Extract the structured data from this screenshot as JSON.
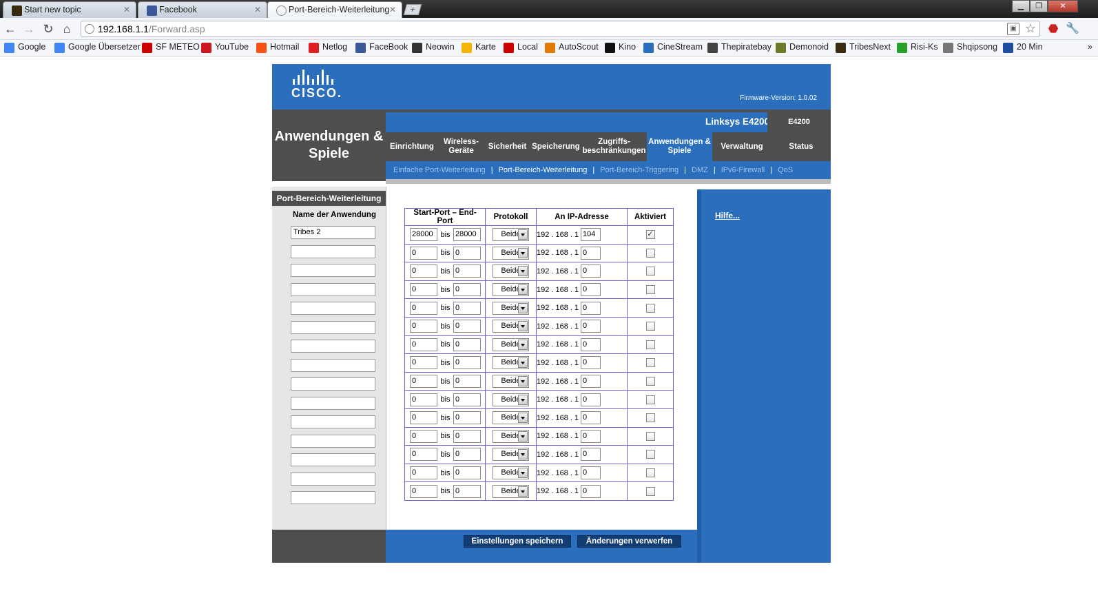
{
  "browser": {
    "tabs": [
      {
        "title": "Start new topic",
        "icon": "tribes-favicon",
        "color": "#3a2a10"
      },
      {
        "title": "Facebook",
        "icon": "facebook-favicon",
        "color": "#3b5998"
      },
      {
        "title": "Port-Bereich-Weiterleitung",
        "icon": "globe-favicon",
        "color": "#888888"
      }
    ],
    "new_tab_label": "+",
    "url_host": "192.168.1.1",
    "url_path": "/Forward.asp",
    "bookmarks": [
      {
        "label": "Google",
        "icon": "google-icon",
        "color": "#4285f4"
      },
      {
        "label": "Google Übersetzer",
        "icon": "translate-icon",
        "color": "#4285f4"
      },
      {
        "label": "SF METEO",
        "icon": "sf-icon",
        "color": "#cc0000"
      },
      {
        "label": "YouTube",
        "icon": "youtube-icon",
        "color": "#cc181e"
      },
      {
        "label": "Hotmail",
        "icon": "windows-icon",
        "color": "#f65314"
      },
      {
        "label": "Netlog",
        "icon": "netlog-icon",
        "color": "#e02020"
      },
      {
        "label": "FaceBook",
        "icon": "facebook-icon",
        "color": "#3b5998"
      },
      {
        "label": "Neowin",
        "icon": "neowin-icon",
        "color": "#333333"
      },
      {
        "label": "Karte",
        "icon": "map-icon",
        "color": "#f4b400"
      },
      {
        "label": "Local",
        "icon": "local-icon",
        "color": "#cc0000"
      },
      {
        "label": "AutoScout",
        "icon": "car-icon",
        "color": "#e07b00"
      },
      {
        "label": "Kino",
        "icon": "kino-icon",
        "color": "#111111"
      },
      {
        "label": "CineStream",
        "icon": "monitor-icon",
        "color": "#2a6ebc"
      },
      {
        "label": "Thepiratebay",
        "icon": "ship-icon",
        "color": "#444444"
      },
      {
        "label": "Demonoid",
        "icon": "demonoid-icon",
        "color": "#6b7a2a"
      },
      {
        "label": "TribesNext",
        "icon": "tribes-icon",
        "color": "#3a2a10"
      },
      {
        "label": "Risi-Ks",
        "icon": "r-icon",
        "color": "#2aa02a"
      },
      {
        "label": "Shqipsong",
        "icon": "globe-icon",
        "color": "#777777"
      },
      {
        "label": "20 Min",
        "icon": "20min-icon",
        "color": "#1f4ea0"
      }
    ]
  },
  "router": {
    "logo_text": "CISCO.",
    "firmware": "Firmware-Version: 1.0.02",
    "section_title_1": "Anwendungen &",
    "section_title_2": "Spiele",
    "model_name": "Linksys E4200",
    "model_badge": "E4200",
    "main_tabs": [
      {
        "l1": "Einrichtung",
        "l2": ""
      },
      {
        "l1": "Wireless-",
        "l2": "Geräte"
      },
      {
        "l1": "Sicherheit",
        "l2": ""
      },
      {
        "l1": "Speicherung",
        "l2": ""
      },
      {
        "l1": "Zugriffs-",
        "l2": "beschränkungen"
      },
      {
        "l1": "Anwendungen &",
        "l2": "Spiele"
      },
      {
        "l1": "Verwaltung",
        "l2": ""
      },
      {
        "l1": "Status",
        "l2": ""
      }
    ],
    "sub_tabs": [
      "Einfache Port-Weiterleitung",
      "Port-Bereich-Weiterleitung",
      "Port-Bereich-Triggering",
      "DMZ",
      "IPv6-Firewall",
      "QoS"
    ],
    "sub_active": 1,
    "left_section": "Port-Bereich-Weiterleitung",
    "name_header": "Name der Anwendung",
    "help_link": "Hilfe...",
    "table_headers": [
      "Start-Port – End-Port",
      "Protokoll",
      "An IP-Adresse",
      "Aktiviert"
    ],
    "bis_label": "bis",
    "ip_prefix": "192 . 168 . 1 .",
    "rows": [
      {
        "name": "Tribes 2",
        "start": "28000",
        "end": "28000",
        "protocol": "Beide",
        "ip": "104",
        "enabled": true
      },
      {
        "name": "",
        "start": "0",
        "end": "0",
        "protocol": "Beide",
        "ip": "0",
        "enabled": false
      },
      {
        "name": "",
        "start": "0",
        "end": "0",
        "protocol": "Beide",
        "ip": "0",
        "enabled": false
      },
      {
        "name": "",
        "start": "0",
        "end": "0",
        "protocol": "Beide",
        "ip": "0",
        "enabled": false
      },
      {
        "name": "",
        "start": "0",
        "end": "0",
        "protocol": "Beide",
        "ip": "0",
        "enabled": false
      },
      {
        "name": "",
        "start": "0",
        "end": "0",
        "protocol": "Beide",
        "ip": "0",
        "enabled": false
      },
      {
        "name": "",
        "start": "0",
        "end": "0",
        "protocol": "Beide",
        "ip": "0",
        "enabled": false
      },
      {
        "name": "",
        "start": "0",
        "end": "0",
        "protocol": "Beide",
        "ip": "0",
        "enabled": false
      },
      {
        "name": "",
        "start": "0",
        "end": "0",
        "protocol": "Beide",
        "ip": "0",
        "enabled": false
      },
      {
        "name": "",
        "start": "0",
        "end": "0",
        "protocol": "Beide",
        "ip": "0",
        "enabled": false
      },
      {
        "name": "",
        "start": "0",
        "end": "0",
        "protocol": "Beide",
        "ip": "0",
        "enabled": false
      },
      {
        "name": "",
        "start": "0",
        "end": "0",
        "protocol": "Beide",
        "ip": "0",
        "enabled": false
      },
      {
        "name": "",
        "start": "0",
        "end": "0",
        "protocol": "Beide",
        "ip": "0",
        "enabled": false
      },
      {
        "name": "",
        "start": "0",
        "end": "0",
        "protocol": "Beide",
        "ip": "0",
        "enabled": false
      },
      {
        "name": "",
        "start": "0",
        "end": "0",
        "protocol": "Beide",
        "ip": "0",
        "enabled": false
      }
    ],
    "save_button": "Einstellungen speichern",
    "discard_button": "Änderungen verwerfen",
    "colors": {
      "blue": "#2a6ebc",
      "dark_gray": "#4e4e4e",
      "table_border": "#6f61c7"
    }
  }
}
